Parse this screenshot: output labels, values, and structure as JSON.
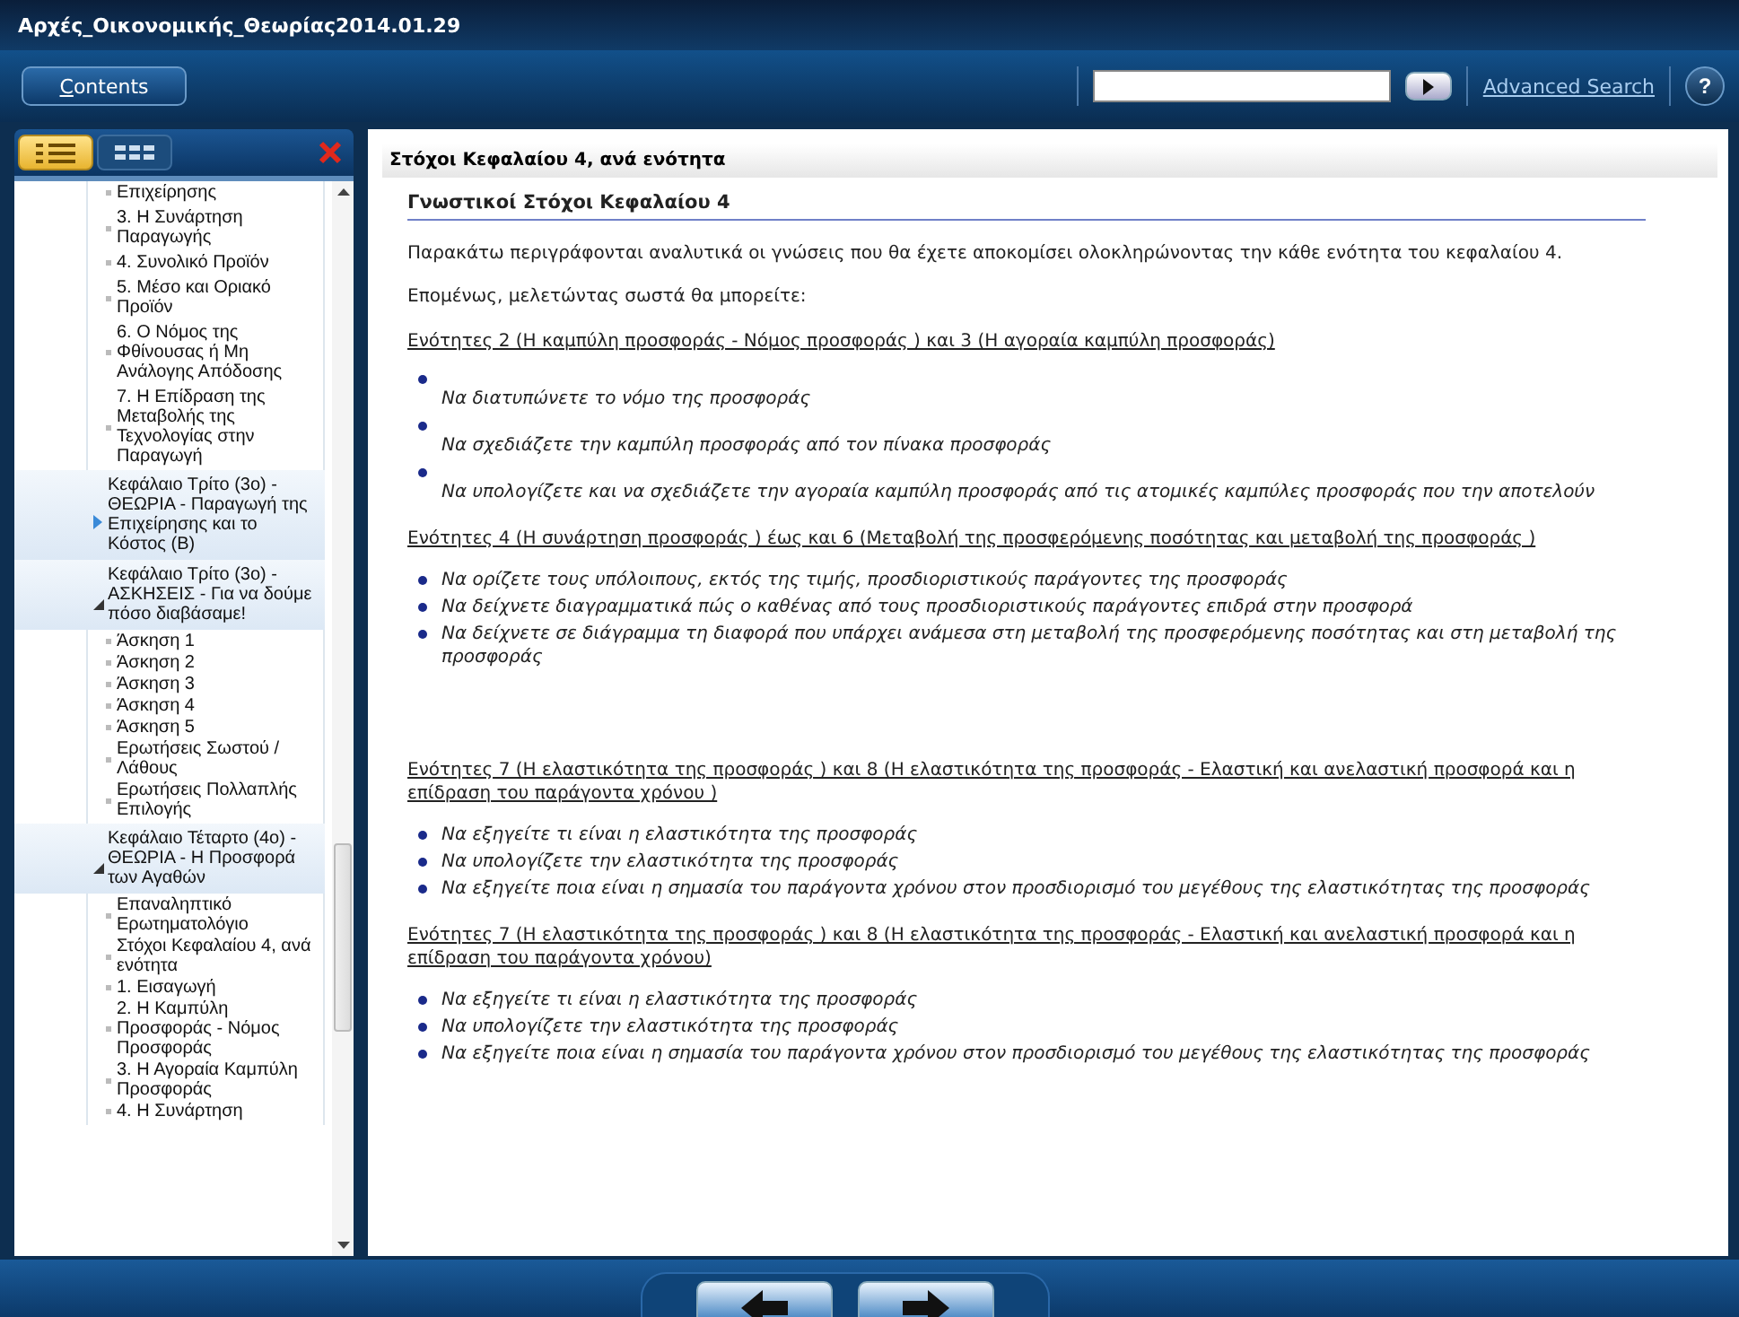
{
  "window": {
    "title": "Αρχές_Οικονομικής_Θεωρίας2014.01.29"
  },
  "toolbar": {
    "contents_button": "Contents",
    "advanced_search": "Advanced Search",
    "help": "?"
  },
  "sidebar": {
    "tabs": [
      {
        "kind": "list",
        "selected": true
      },
      {
        "kind": "grid",
        "selected": false
      }
    ],
    "items": [
      {
        "kind": "topic",
        "label": "Επιχείρησης"
      },
      {
        "kind": "topic",
        "label": "3. Η Συνάρτηση Παραγωγής"
      },
      {
        "kind": "topic",
        "label": "4. Συνολικό Προϊόν"
      },
      {
        "kind": "topic",
        "label": "5. Μέσο και Οριακό Προϊόν"
      },
      {
        "kind": "topic",
        "label": "6. Ο Νόμος της Φθίνουσας ή Μη Ανάλογης Απόδοσης"
      },
      {
        "kind": "topic",
        "label": "7. Η Επίδραση της Μεταβολής της Τεχνολογίας στην Παραγωγή"
      },
      {
        "kind": "chapter",
        "label": "Κεφάλαιο Τρίτο (3ο) - ΘΕΩΡΙΑ - Παραγωγή της Επιχείρησης και το Κόστος (Β)",
        "expanded": false
      },
      {
        "kind": "chapter",
        "label": "Κεφάλαιο Τρίτο (3ο) - ΑΣΚΗΣΕΙΣ - Για να δούμε πόσο διαβάσαμε!",
        "expanded": true,
        "children": [
          {
            "kind": "topic",
            "label": "Άσκηση 1"
          },
          {
            "kind": "topic",
            "label": "Άσκηση 2"
          },
          {
            "kind": "topic",
            "label": "Άσκηση 3"
          },
          {
            "kind": "topic",
            "label": "Άσκηση 4"
          },
          {
            "kind": "topic",
            "label": "Άσκηση 5"
          },
          {
            "kind": "topic",
            "label": "Ερωτήσεις Σωστού / Λάθους"
          },
          {
            "kind": "topic",
            "label": "Ερωτήσεις Πολλαπλής Επιλογής"
          }
        ]
      },
      {
        "kind": "chapter",
        "label": "Κεφάλαιο Τέταρτο (4ο) - ΘΕΩΡΙΑ - Η Προσφορά των Αγαθών",
        "expanded": true,
        "children": [
          {
            "kind": "topic",
            "label": "Επαναληπτικό Ερωτηματολόγιο"
          },
          {
            "kind": "topic",
            "label": "Στόχοι Κεφαλαίου 4, ανά ενότητα"
          },
          {
            "kind": "topic",
            "label": "1. Εισαγωγή"
          },
          {
            "kind": "topic",
            "label": "2. Η Καμπύλη Προσφοράς - Νόμος Προσφοράς"
          },
          {
            "kind": "topic",
            "label": "3. Η Αγοραία Καμπύλη Προσφοράς"
          },
          {
            "kind": "topic",
            "label": "4. Η Συνάρτηση"
          }
        ]
      }
    ]
  },
  "content": {
    "page_title": "Στόχοι Κεφαλαίου 4, ανά ενότητα",
    "heading": "Γνωστικοί Στόχοι Κεφαλαίου 4",
    "paragraphs": [
      "Παρακάτω περιγράφονται αναλυτικά οι γνώσεις που θα έχετε αποκομίσει ολοκληρώνοντας την κάθε ενότητα του κεφαλαίου 4.",
      "Επομένως, μελετώντας σωστά θα μπορείτε:"
    ],
    "sections": [
      {
        "kind": "stacked",
        "title": "Ενότητες 2 (Η καμπύλη προσφοράς - Νόμος προσφοράς ) και 3 (Η αγοραία καμπύλη προσφοράς)",
        "bullets": [
          "Να διατυπώνετε το νόμο της προσφοράς",
          "Να σχεδιάζετε την καμπύλη προσφοράς από τον πίνακα προσφοράς",
          "Να υπολογίζετε και να σχεδιάζετε την αγοραία καμπύλη προσφοράς από τις ατομικές καμπύλες προσφοράς που την αποτελούν"
        ]
      },
      {
        "kind": "inline",
        "title": "Ενότητες 4 (Η συνάρτηση προσφοράς ) έως και 6 (Μεταβολή της προσφερόμενης ποσότητας και μεταβολή της προσφοράς )",
        "bullets": [
          "Να ορίζετε τους υπόλοιπους, εκτός της τιμής, προσδιοριστικούς παράγοντες της προσφοράς",
          "Να δείχνετε διαγραμματικά πώς ο καθένας από τους προσδιοριστικούς παράγοντες επιδρά στην προσφορά",
          "Να δείχνετε σε διάγραμμα τη διαφορά που υπάρχει ανάμεσα στη μεταβολή της προσφερόμενης ποσότητας και στη μεταβολή της προσφοράς"
        ]
      },
      {
        "kind": "inline",
        "title": "Ενότητες 7 (Η ελαστικότητα της προσφοράς ) και 8 (Η ελαστικότητα της προσφοράς - Ελαστική και ανελαστική προσφορά και η επίδραση του παράγοντα χρόνου )",
        "bullets": [
          "Να εξηγείτε τι είναι η ελαστικότητα της προσφοράς",
          "Να υπολογίζετε την ελαστικότητα της προσφοράς",
          "Να εξηγείτε ποια είναι η σημασία του παράγοντα χρόνου στον προσδιορισμό του μεγέθους της ελαστικότητας της προσφοράς"
        ]
      },
      {
        "kind": "inline",
        "title": "Ενότητες 7 (Η ελαστικότητα της προσφοράς ) και 8 (Η ελαστικότητα της προσφοράς - Ελαστική και ανελαστική προσφορά και η επίδραση του παράγοντα χρόνου)",
        "bullets": [
          "Να εξηγείτε τι είναι η ελαστικότητα της προσφοράς",
          "Να υπολογίζετε την ελαστικότητα της προσφοράς",
          "Να εξηγείτε ποια είναι η σημασία του παράγοντα χρόνου στον προσδιορισμό του μεγέθους της ελαστικότητας της προσφοράς"
        ]
      }
    ]
  }
}
